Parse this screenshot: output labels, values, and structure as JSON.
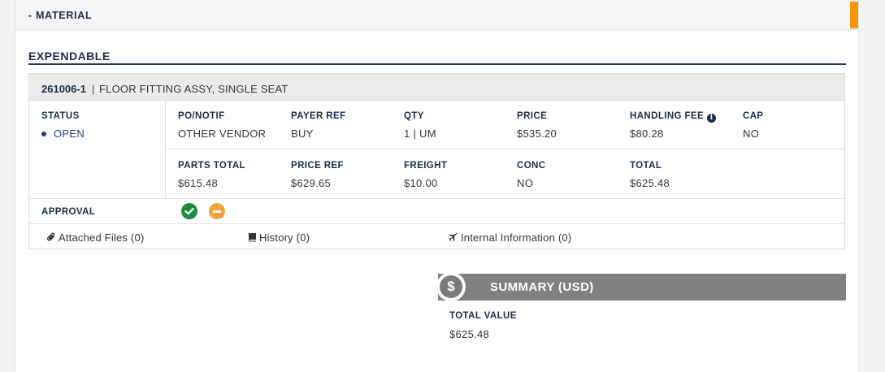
{
  "material": {
    "header": "- MATERIAL",
    "section_title": "EXPENDABLE",
    "item": {
      "part_number": "261006-1",
      "separator": "|",
      "description": "FLOOR FITTING ASSY, SINGLE SEAT",
      "status_label": "STATUS",
      "status_value": "OPEN",
      "fields_row1": [
        {
          "label": "PO/NOTIF",
          "value": "OTHER VENDOR"
        },
        {
          "label": "PAYER REF",
          "value": "BUY"
        },
        {
          "label": "QTY",
          "value": "1 | UM"
        },
        {
          "label": "PRICE",
          "value": "$535.20"
        },
        {
          "label": "HANDLING FEE",
          "value": "$80.28"
        },
        {
          "label": "CAP",
          "value": "NO"
        }
      ],
      "fields_row2": [
        {
          "label": "PARTS TOTAL",
          "value": "$615.48"
        },
        {
          "label": "PRICE REF",
          "value": "$629.65"
        },
        {
          "label": "FREIGHT",
          "value": "$10.00"
        },
        {
          "label": "CONC",
          "value": "NO"
        },
        {
          "label": "TOTAL",
          "value": "$625.48"
        }
      ],
      "approval_label": "APPROVAL",
      "links": {
        "attached_files": "Attached Files (0)",
        "history": "History (0)",
        "internal_information": "Internal Information (0)"
      }
    }
  },
  "summary": {
    "icon_glyph": "$",
    "title": "SUMMARY (USD)",
    "total_value_label": "TOTAL VALUE",
    "total_value": "$625.48"
  },
  "colors": {
    "accent": "#f5960d",
    "approved": "#1e8a3c",
    "pending": "#f2a33c",
    "status_open": "#1a3f8c",
    "summary_bar": "#808080"
  },
  "icons": {
    "header_toggle": "collapse",
    "info": "info-circle-icon",
    "approved": "check-circle-icon",
    "pending": "minus-circle-icon",
    "attached_files": "paperclip-icon",
    "history": "book-icon",
    "internal_information": "plane-icon",
    "summary": "dollar-icon"
  }
}
